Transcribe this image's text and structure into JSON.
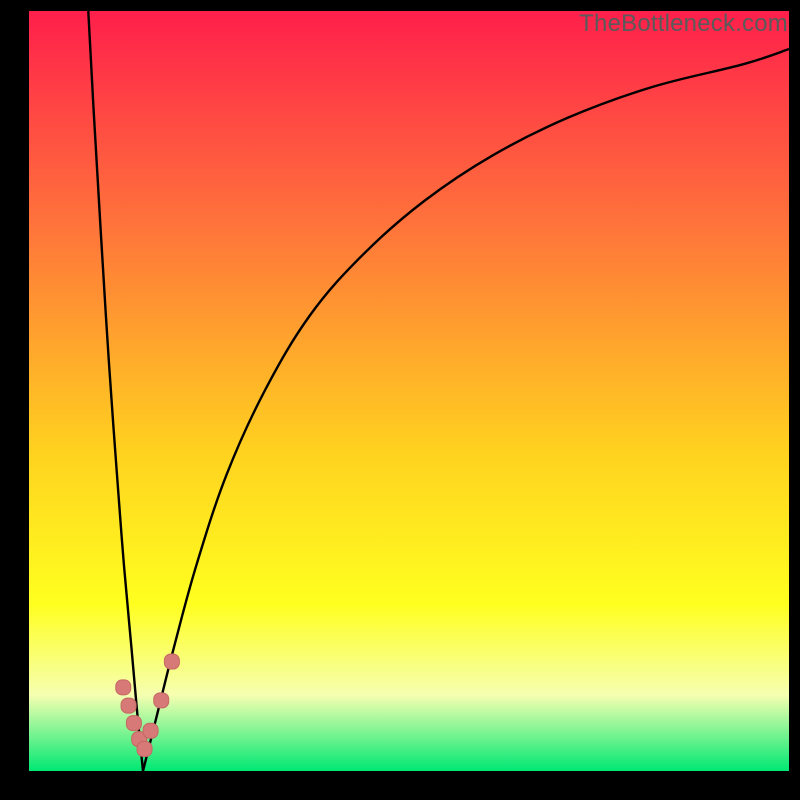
{
  "watermark": "TheBottleneck.com",
  "colors": {
    "gradient_top": "#ff1f4b",
    "gradient_mid1": "#ff733b",
    "gradient_mid2": "#ffd21f",
    "gradient_mid3": "#ffff1f",
    "gradient_mid4": "#f6ffb0",
    "gradient_bottom": "#00e874",
    "curve": "#000000",
    "marker_fill": "#d77a77",
    "marker_stroke": "#c46863"
  },
  "chart_data": {
    "type": "line",
    "title": "",
    "xlabel": "",
    "ylabel": "",
    "xlim": [
      0,
      100
    ],
    "ylim": [
      0,
      100
    ],
    "note": "Bottleneck-style curve; x is an arbitrary balance parameter, y is bottleneck %. Minimum at x≈15, y≈0. Left branch near-vertical, right branch rises with diminishing slope toward y≈100.",
    "series": [
      {
        "name": "bottleneck-curve-left",
        "x": [
          7.8,
          8.5,
          9.5,
          10.5,
          11.5,
          12.5,
          13.5,
          14.3,
          15.0
        ],
        "y": [
          100,
          87,
          70,
          54,
          40,
          27,
          16,
          7,
          0
        ]
      },
      {
        "name": "bottleneck-curve-right",
        "x": [
          15.0,
          17,
          19,
          22,
          26,
          31,
          37,
          44,
          52,
          61,
          71,
          82,
          94,
          100
        ],
        "y": [
          0,
          8,
          16,
          27,
          39,
          50,
          60,
          68,
          75,
          81,
          86,
          90,
          93,
          95
        ]
      }
    ],
    "markers": {
      "name": "highlight-points",
      "x": [
        12.4,
        13.1,
        13.8,
        14.5,
        15.2,
        16.0,
        17.4,
        18.8
      ],
      "y": [
        11.0,
        8.6,
        6.3,
        4.2,
        2.9,
        5.3,
        9.3,
        14.4
      ]
    }
  }
}
